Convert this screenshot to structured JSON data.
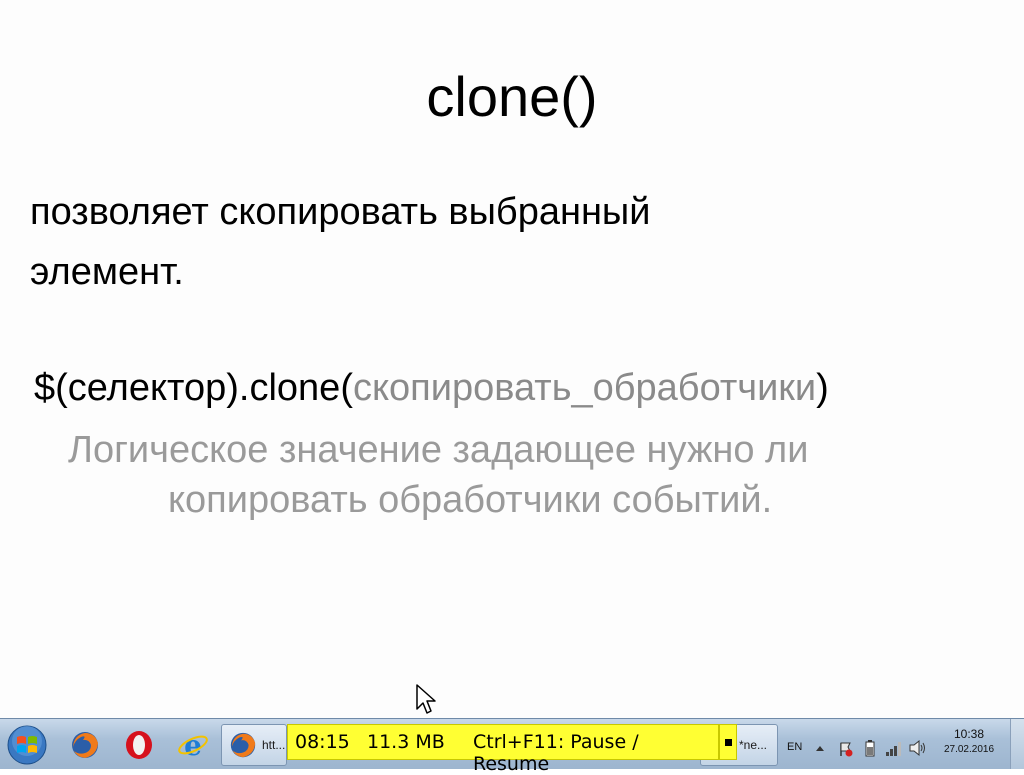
{
  "slide": {
    "title": "clone()",
    "description_line1": "позволяет скопировать выбранный",
    "description_line2": "элемент.",
    "syntax_prefix": "$(селектор).clone(",
    "syntax_param": "скопировать_обработчики",
    "syntax_suffix": ")",
    "param_desc_line1": "Логическое значение задающее нужно ли",
    "param_desc_line2": "копировать обработчики событий."
  },
  "recorder_overlay": {
    "elapsed": "08:15",
    "size": "11.3 MB",
    "hint": "Ctrl+F11: Pause / Resume"
  },
  "taskbar": {
    "pinned": [
      {
        "icon": "firefox-icon"
      },
      {
        "icon": "opera-icon"
      },
      {
        "icon": "internet-explorer-icon"
      }
    ],
    "windows": [
      {
        "label": "htt...",
        "icon": "firefox-icon"
      },
      {
        "label": "*ne...",
        "icon": "notepad-icon"
      }
    ],
    "language": "EN",
    "time": "10:38",
    "date": "27.02.2016"
  },
  "colors": {
    "overlay_bg": "#ffff33",
    "param_gray": "#8a8a8a",
    "desc_gray": "#9a9a9a"
  }
}
